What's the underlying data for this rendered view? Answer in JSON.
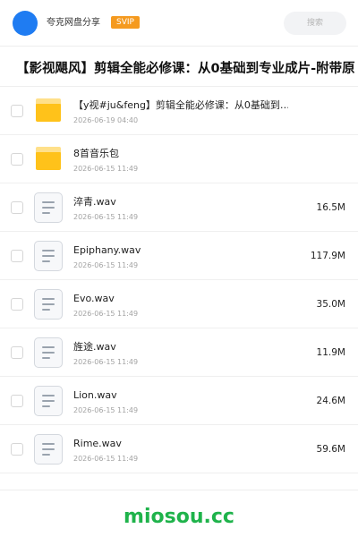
{
  "header": {
    "user_name": "夸克网盘分享",
    "badge": "SVIP",
    "search_placeholder": "搜索",
    "avatar_color": "#1f7cf2",
    "badge_color": "#f59a1f"
  },
  "share_title": "【影视飓风】剪辑全能必修课：从0基础到专业成片-附带原",
  "files": [
    {
      "type": "folder",
      "icon": "folder-icon",
      "name": "【y视#ju&feng】剪辑全能必修课：从0基础到…",
      "date": "2026-06-19 04:40",
      "size": ""
    },
    {
      "type": "folder",
      "icon": "folder-icon",
      "name": "8首音乐包",
      "date": "2026-06-15 11:49",
      "size": ""
    },
    {
      "type": "file",
      "icon": "document-icon",
      "name": "淬青.wav",
      "date": "2026-06-15 11:49",
      "size": "16.5M"
    },
    {
      "type": "file",
      "icon": "document-icon",
      "name": "Epiphany.wav",
      "date": "2026-06-15 11:49",
      "size": "117.9M"
    },
    {
      "type": "file",
      "icon": "document-icon",
      "name": "Evo.wav",
      "date": "2026-06-15 11:49",
      "size": "35.0M"
    },
    {
      "type": "file",
      "icon": "document-icon",
      "name": "旌途.wav",
      "date": "2026-06-15 11:49",
      "size": "11.9M"
    },
    {
      "type": "file",
      "icon": "document-icon",
      "name": "Lion.wav",
      "date": "2026-06-15 11:49",
      "size": "24.6M"
    },
    {
      "type": "file",
      "icon": "document-icon",
      "name": "Rime.wav",
      "date": "2026-06-15 11:49",
      "size": "59.6M"
    }
  ],
  "watermark": "miosou.cc",
  "colors": {
    "folder": "#ffc21a",
    "watermark": "#1fb34b"
  }
}
